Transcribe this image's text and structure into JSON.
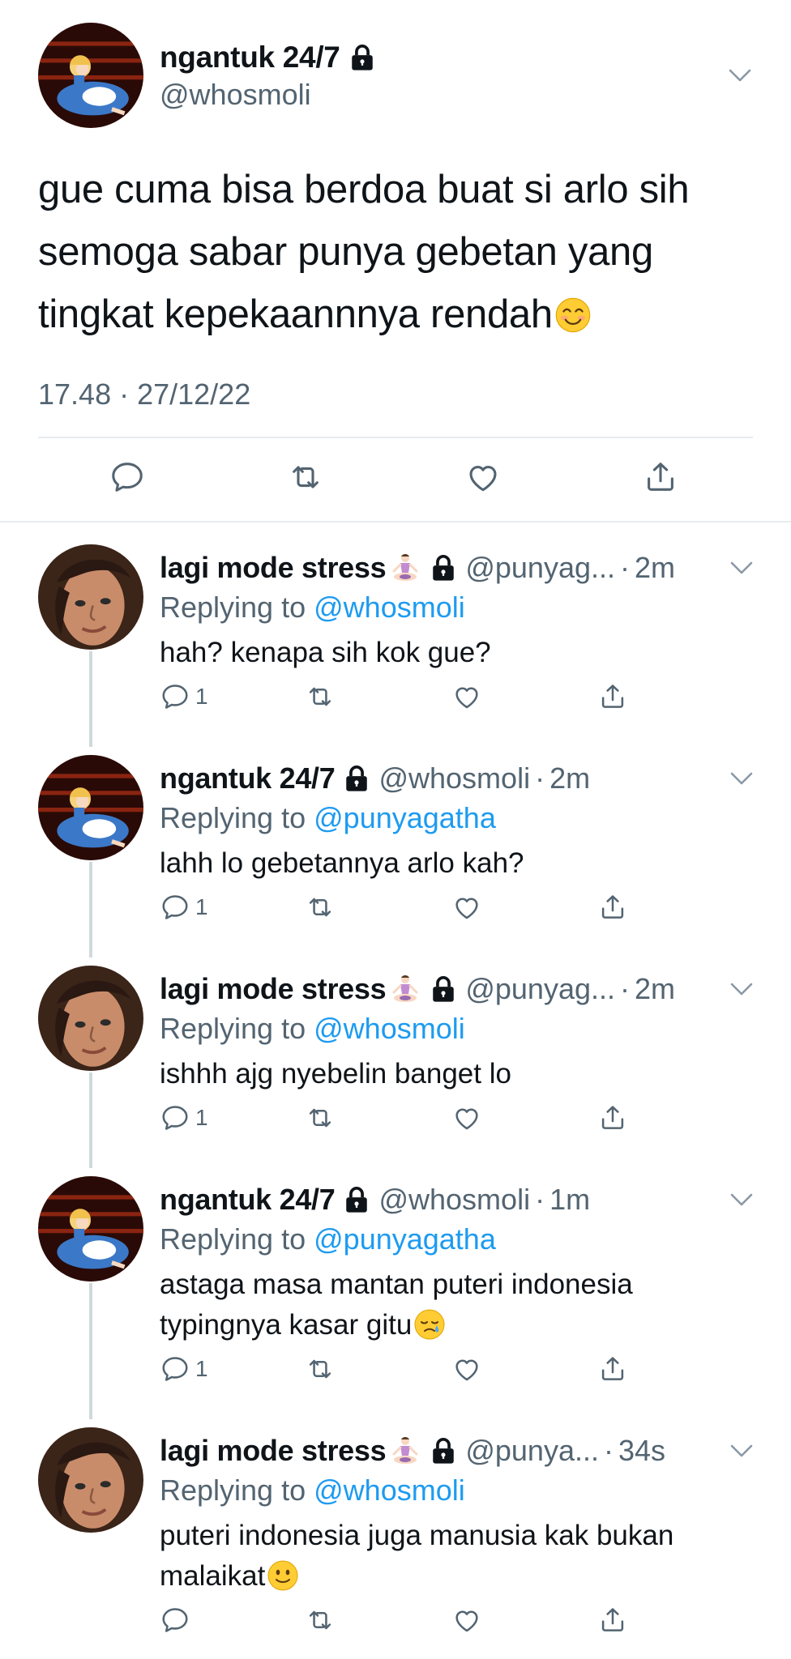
{
  "tweet": {
    "name": "ngantuk 24/7",
    "handle": "@whosmoli",
    "text": "gue cuma bisa berdoa buat si arlo sih semoga sabar punya gebetan yang tingkat kepekaannnya rendah",
    "text_emoji": "smiling-face-icon",
    "timestamp": "17.48 · 27/12/22",
    "actions": [
      "reply-icon",
      "retweet-icon",
      "like-icon",
      "share-icon"
    ]
  },
  "replies": [
    {
      "name": "lagi mode stress",
      "handle": "@punyag...",
      "time": "2m",
      "replying_prefix": "Replying to",
      "mention": "@whosmoli",
      "text": "hah? kenapa sih kok gue?",
      "reply_count": "1"
    },
    {
      "name": "ngantuk 24/7",
      "handle": "@whosmoli",
      "time": "2m",
      "replying_prefix": "Replying to",
      "mention": "@punyagatha",
      "text": "lahh lo gebetannya arlo kah?",
      "reply_count": "1"
    },
    {
      "name": "lagi mode stress",
      "handle": "@punyag...",
      "time": "2m",
      "replying_prefix": "Replying to",
      "mention": "@whosmoli",
      "text": "ishhh ajg nyebelin banget lo",
      "reply_count": "1"
    },
    {
      "name": "ngantuk 24/7",
      "handle": "@whosmoli",
      "time": "1m",
      "replying_prefix": "Replying to",
      "mention": "@punyagatha",
      "text": "astaga masa mantan puteri indonesia typingnya kasar gitu",
      "reply_count": "1"
    },
    {
      "name": "lagi mode stress",
      "handle": "@punya...",
      "time": "34s",
      "replying_prefix": "Replying to",
      "mention": "@whosmoli",
      "text": "puteri indonesia juga manusia kak bukan malaikat",
      "reply_count": ""
    }
  ],
  "colors": {
    "link": "#1d9bf0",
    "secondary_text": "#536471",
    "divider": "#e6ecf0",
    "thread_line": "#cfd9de"
  }
}
